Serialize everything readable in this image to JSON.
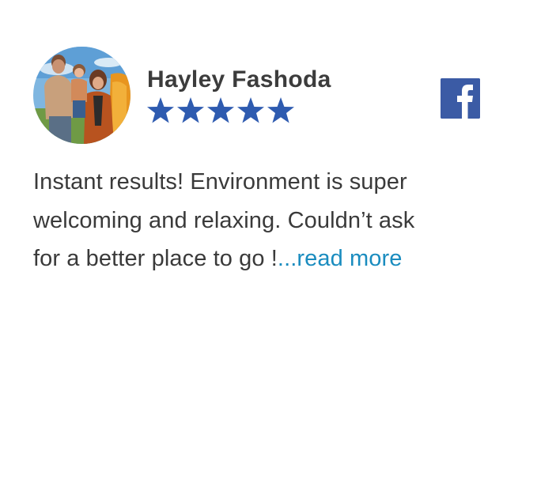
{
  "review": {
    "reviewer_name": "Hayley Fashoda",
    "rating": 5,
    "max_rating": 5,
    "text_lines": [
      "Instant results! Environment is super",
      "welcoming and relaxing. Couldn’t ask",
      "for a better place to go !"
    ],
    "read_more_label": "...read more",
    "source_icon": "facebook-icon",
    "avatar_icon": "avatar-photo"
  },
  "colors": {
    "star": "#2e5bb0",
    "facebook": "#3b5ba5",
    "name_text": "#3c3c3c",
    "body_text": "#3a3a3a",
    "link": "#1a8cbf"
  }
}
